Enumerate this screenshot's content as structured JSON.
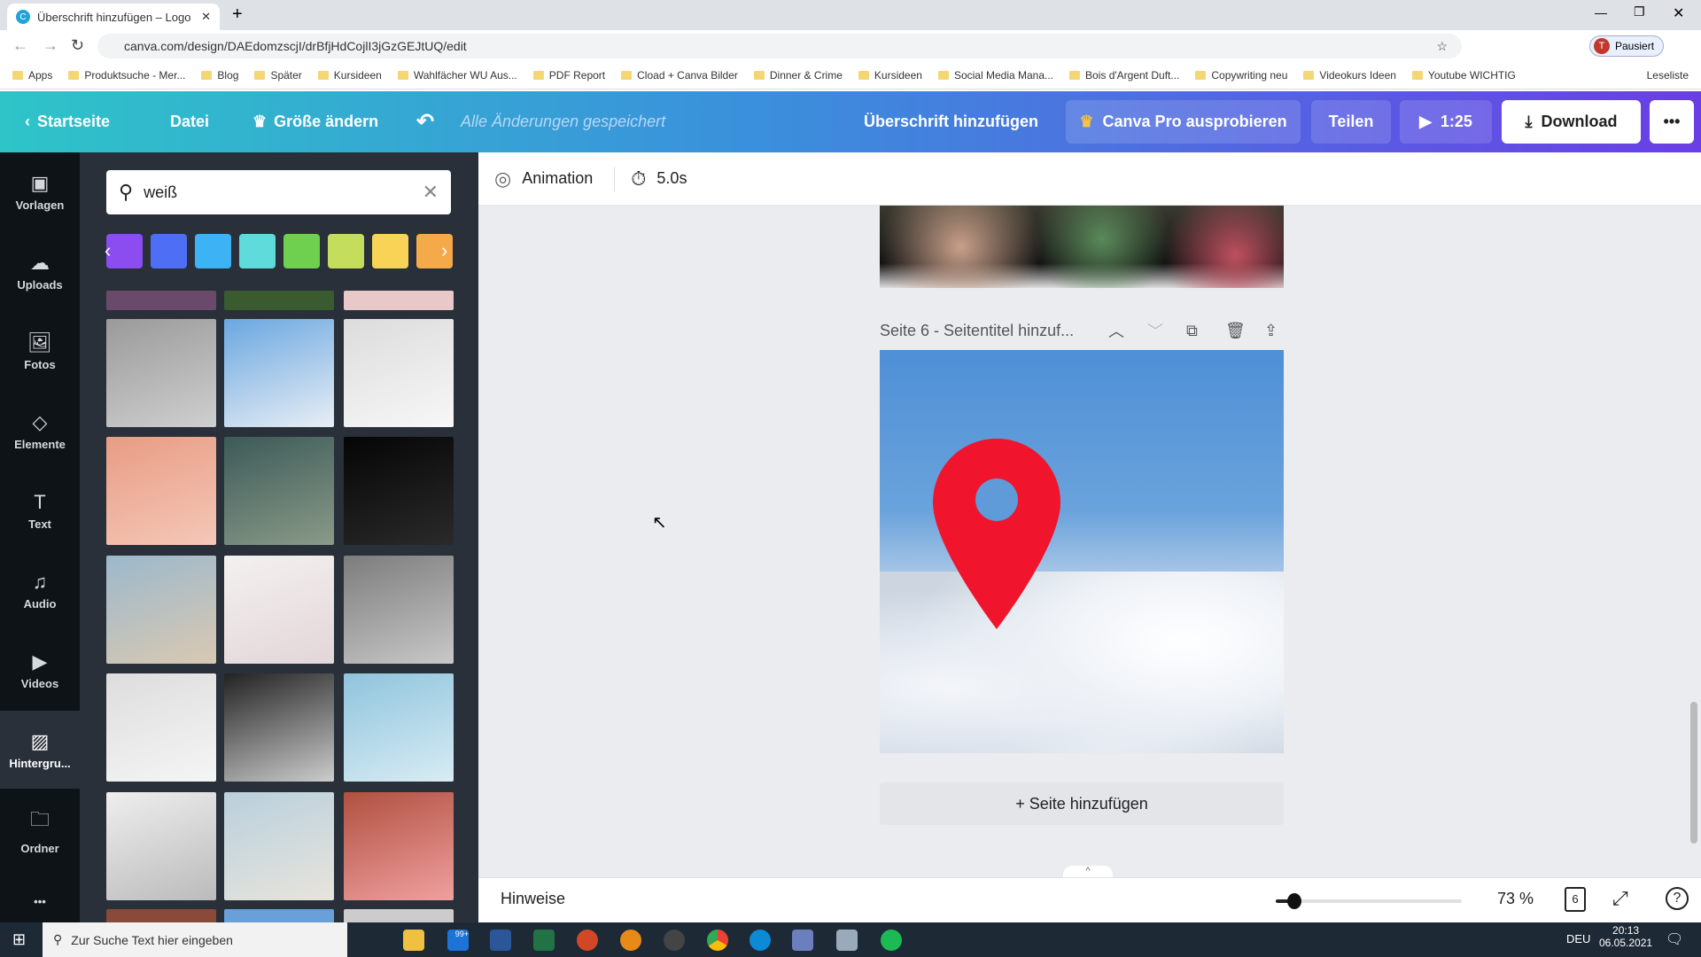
{
  "browser": {
    "tab_title": "Überschrift hinzufügen – Logo",
    "url": "canva.com/design/DAEdomzscjI/drBfjHdCojlI3jGzGEJtUQ/edit",
    "profile": "Pausiert",
    "bookmarks": [
      "Apps",
      "Produktsuche - Mer...",
      "Blog",
      "Später",
      "Kursideen",
      "Wahlfächer WU Aus...",
      "PDF Report",
      "Cload + Canva Bilder",
      "Dinner & Crime",
      "Kursideen",
      "Social Media Mana...",
      "Bois d'Argent Duft...",
      "Copywriting neu",
      "Videokurs Ideen",
      "Youtube WICHTIG"
    ],
    "reading_list": "Leseliste"
  },
  "header": {
    "home": "Startseite",
    "file": "Datei",
    "resize": "Größe ändern",
    "saved_status": "Alle Änderungen gespeichert",
    "title": "Überschrift hinzufügen",
    "pro": "Canva Pro ausprobieren",
    "share": "Teilen",
    "play_duration": "1:25",
    "download": "Download"
  },
  "sidebar": {
    "items": [
      {
        "label": "Vorlagen",
        "icon": "template-icon"
      },
      {
        "label": "Uploads",
        "icon": "upload-icon"
      },
      {
        "label": "Fotos",
        "icon": "photo-icon"
      },
      {
        "label": "Elemente",
        "icon": "elements-icon"
      },
      {
        "label": "Text",
        "icon": "text-icon"
      },
      {
        "label": "Audio",
        "icon": "audio-icon"
      },
      {
        "label": "Videos",
        "icon": "video-icon"
      },
      {
        "label": "Hintergru...",
        "icon": "background-icon"
      },
      {
        "label": "Ordner",
        "icon": "folder-icon"
      }
    ],
    "active": "Hintergru..."
  },
  "panel": {
    "search_value": "weiß",
    "colors": [
      "#8b4cf0",
      "#4d6ef5",
      "#3db2f5",
      "#5fdbdb",
      "#6fcf4f",
      "#c4dd5c",
      "#f9d356",
      "#f4a94a"
    ]
  },
  "toolbar": {
    "animation": "Animation",
    "duration": "5.0s"
  },
  "page": {
    "title": "Seite 6 - Seitentitel hinzuf...",
    "add_page": "+ Seite hinzufügen",
    "pin_color": "#f0142c"
  },
  "footer": {
    "notes": "Hinweise",
    "zoom": "73 %",
    "zoom_fraction": 0.1,
    "page_count": "6"
  },
  "taskbar": {
    "search_placeholder": "Zur Suche Text hier eingeben",
    "mail_badge": "99+",
    "lang": "DEU",
    "time": "20:13",
    "date": "06.05.2021"
  }
}
